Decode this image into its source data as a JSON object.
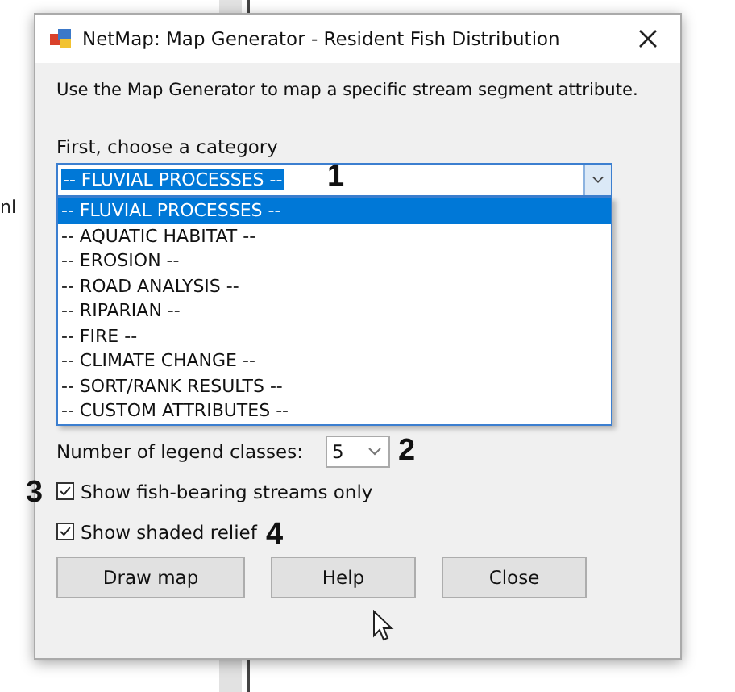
{
  "background_text": "nl",
  "window": {
    "title": "NetMap: Map Generator - Resident Fish Distribution"
  },
  "intro": "Use the Map Generator to map a specific stream segment attribute.",
  "category": {
    "label": "First, choose a category",
    "value": "-- FLUVIAL PROCESSES --",
    "expanded": true,
    "options": [
      {
        "label": "-- FLUVIAL PROCESSES --",
        "selected": true
      },
      {
        "label": "-- AQUATIC HABITAT --",
        "selected": false
      },
      {
        "label": "-- EROSION --",
        "selected": false
      },
      {
        "label": "-- ROAD ANALYSIS --",
        "selected": false
      },
      {
        "label": "-- RIPARIAN --",
        "selected": false
      },
      {
        "label": "-- FIRE --",
        "selected": false
      },
      {
        "label": "-- CLIMATE CHANGE --",
        "selected": false
      },
      {
        "label": "-- SORT/RANK RESULTS --",
        "selected": false
      },
      {
        "label": "-- CUSTOM ATTRIBUTES --",
        "selected": false
      }
    ]
  },
  "legend_classes": {
    "label": "Number of legend classes:",
    "value": "5"
  },
  "checkboxes": [
    {
      "label": "Show fish-bearing streams only",
      "checked": true
    },
    {
      "label": "Show shaded relief",
      "checked": true
    }
  ],
  "buttons": [
    "Draw map",
    "Help",
    "Close"
  ],
  "annotations": [
    "1",
    "2",
    "3",
    "4"
  ]
}
